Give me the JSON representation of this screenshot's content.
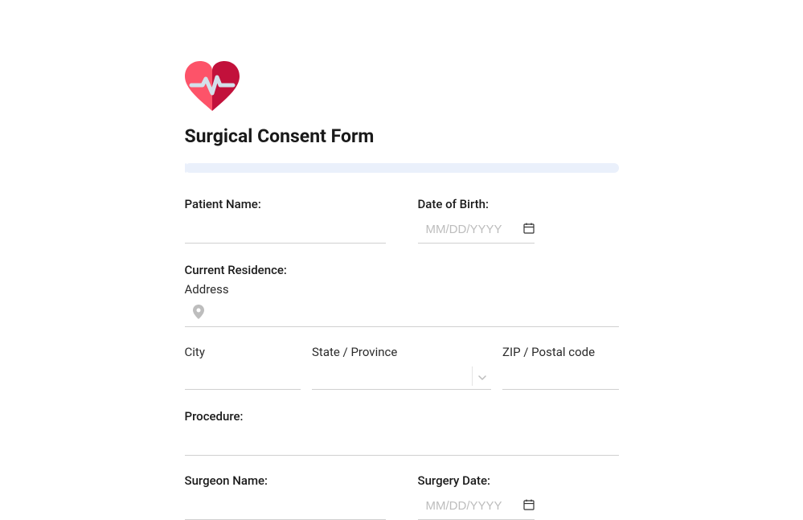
{
  "title": "Surgical Consent Form",
  "fields": {
    "patient_name": {
      "label": "Patient Name:"
    },
    "dob": {
      "label": "Date of Birth:",
      "placeholder": "MM/DD/YYYY"
    },
    "residence": {
      "label": "Current Residence:"
    },
    "address": {
      "label": "Address"
    },
    "city": {
      "label": "City"
    },
    "state": {
      "label": "State / Province"
    },
    "zip": {
      "label": "ZIP / Postal code"
    },
    "procedure": {
      "label": "Procedure:"
    },
    "surgeon_name": {
      "label": "Surgeon Name:"
    },
    "surgery_date": {
      "label": "Surgery Date:",
      "placeholder": "MM/DD/YYYY"
    }
  }
}
